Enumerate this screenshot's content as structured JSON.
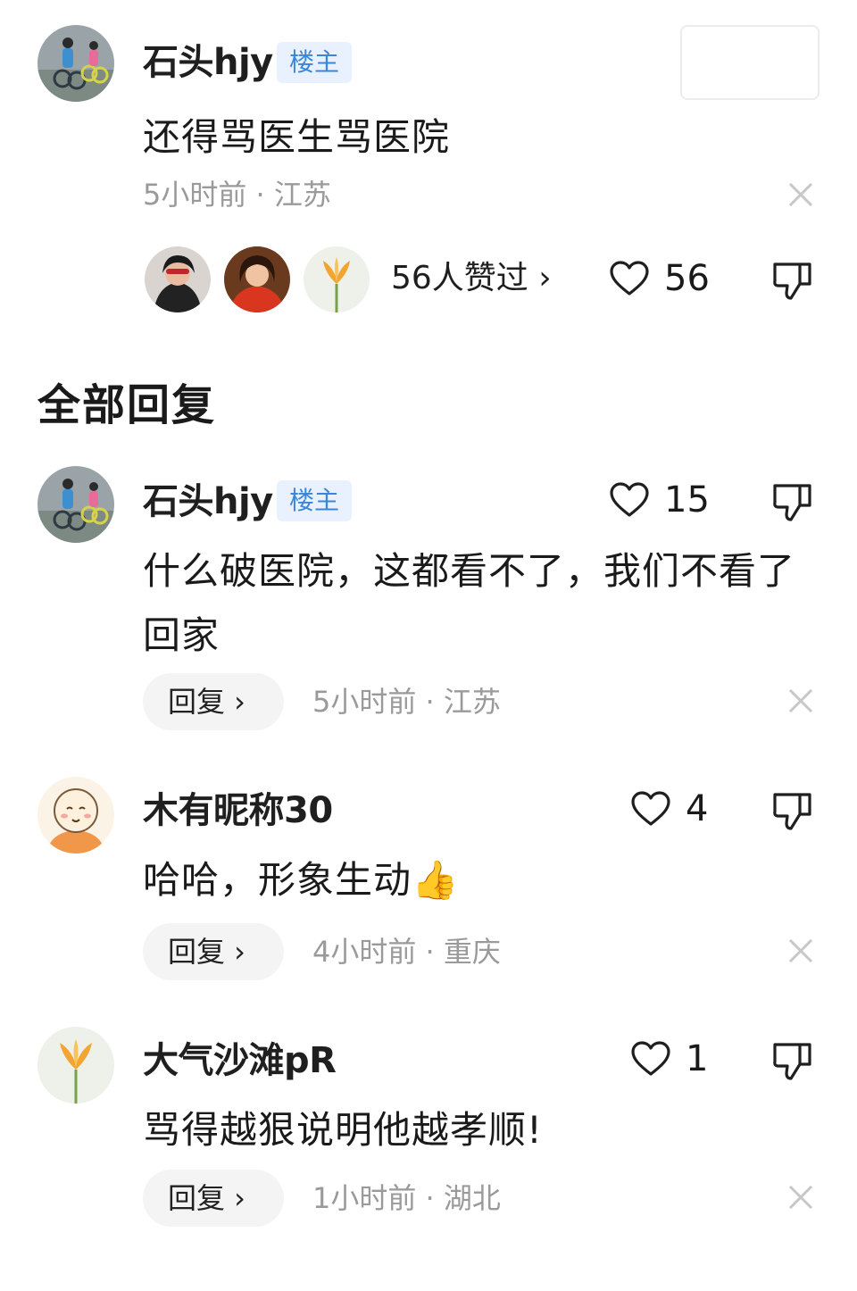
{
  "main_comment": {
    "user": "石头hjy",
    "badge": "楼主",
    "text": "还得骂医生骂医院",
    "time_location": "5小时前 · 江苏",
    "liked_by_label": "56人赞过 ›",
    "like_count": "56"
  },
  "section_title": "全部回复",
  "replies": [
    {
      "user": "石头hjy",
      "badge": "楼主",
      "text": "什么破医院，这都看不了，我们不看了回家",
      "reply_label": "回复 ›",
      "time_location": "5小时前 · 江苏",
      "like_count": "15"
    },
    {
      "user": "木有昵称30",
      "text": "哈哈，形象生动",
      "emoji": "👍",
      "reply_label": "回复 ›",
      "time_location": "4小时前 · 重庆",
      "like_count": "4"
    },
    {
      "user": "大气沙滩pR",
      "text": "骂得越狠说明他越孝顺!",
      "reply_label": "回复 ›",
      "time_location": "1小时前 · 湖北",
      "like_count": "1"
    }
  ],
  "colors": {
    "badge_bg": "#e8f1fd",
    "badge_text": "#3b86d8",
    "meta_text": "#9a9a9a",
    "reply_pill_bg": "#f4f4f4"
  }
}
